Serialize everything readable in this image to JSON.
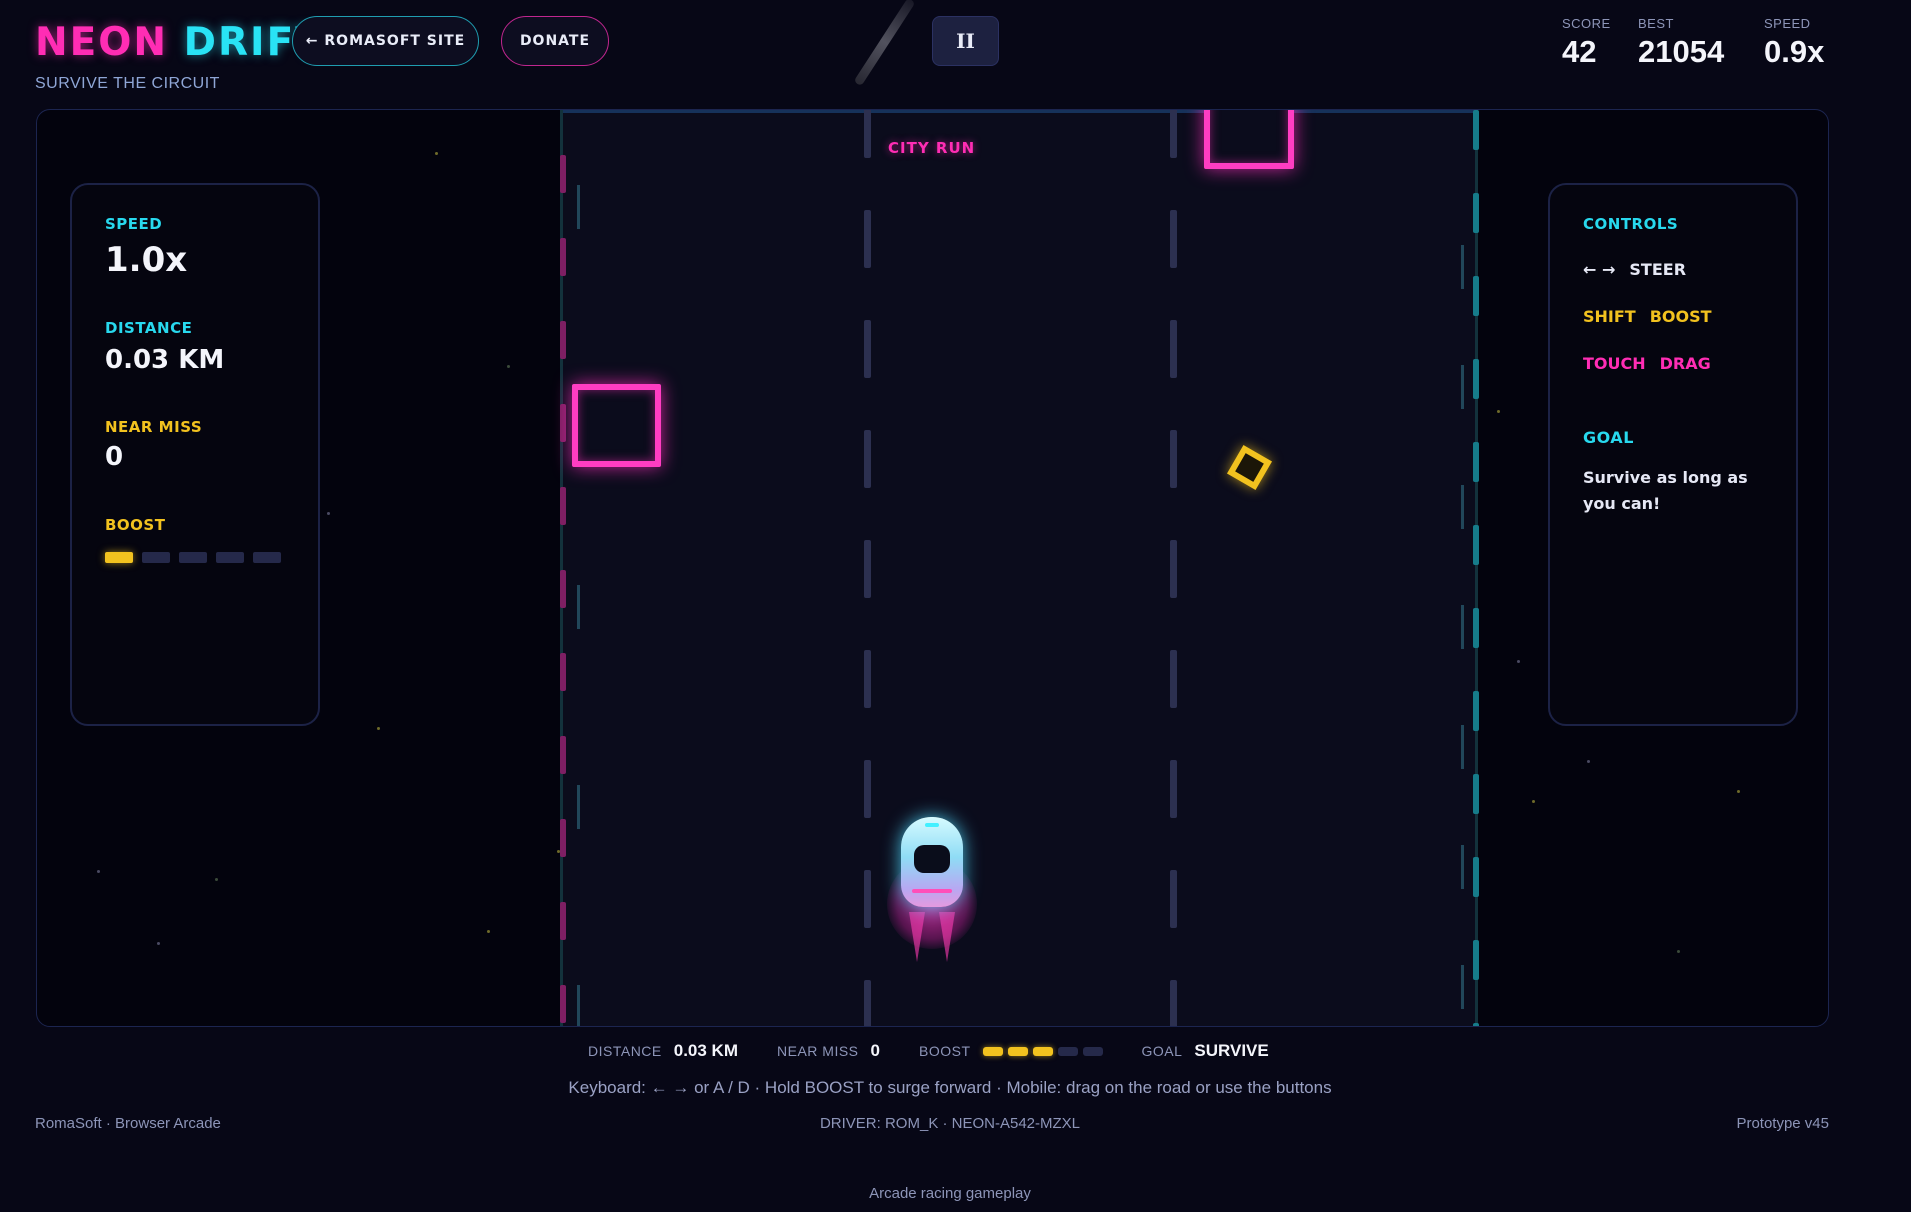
{
  "header": {
    "title_part1": "NEON",
    "title_part2": "DRIFT",
    "tagline": "SURVIVE THE CIRCUIT",
    "site_button": "← ROMASOFT SITE",
    "donate_button": "DONATE",
    "pause_button": "II"
  },
  "top_hud": {
    "score_label": "SCORE",
    "score_value": "42",
    "best_label": "BEST",
    "best_value": "21054",
    "speed_label": "SPEED",
    "speed_value": "0.9x"
  },
  "game": {
    "zone_label": "CITY RUN"
  },
  "left_panel": {
    "speed_label": "SPEED",
    "speed_value": "1.0x",
    "distance_label": "DISTANCE",
    "distance_value": "0.03 KM",
    "near_miss_label": "NEAR MISS",
    "near_miss_value": "0",
    "boost_label": "BOOST",
    "boost_level": 1,
    "boost_max": 5
  },
  "right_panel": {
    "controls_label": "CONTROLS",
    "steer_keys": "← →",
    "steer_action": "STEER",
    "boost_key": "SHIFT",
    "boost_action": "BOOST",
    "touch_key": "TOUCH",
    "touch_action": "DRAG",
    "goal_label": "GOAL",
    "goal_text": "Survive as long as you can!"
  },
  "bottom_hud": {
    "distance_label": "DISTANCE",
    "distance_value": "0.03 KM",
    "near_miss_label": "NEAR MISS",
    "near_miss_value": "0",
    "boost_label": "BOOST",
    "boost_level": 3,
    "boost_max": 5,
    "goal_label": "GOAL",
    "goal_value": "SURVIVE"
  },
  "help_text": "Keyboard: ← → or A / D · Hold BOOST to surge forward · Mobile: drag on the road or use the buttons",
  "footer": {
    "left": "RomaSoft · Browser Arcade",
    "center": "DRIVER: ROM_K · NEON-A542-MZXL",
    "right": "Prototype v45"
  },
  "caption": "Arcade racing gameplay",
  "colors": {
    "pink": "#ff2db4",
    "cyan": "#28d9ee",
    "yellow": "#f2c21f",
    "background": "#070716"
  }
}
